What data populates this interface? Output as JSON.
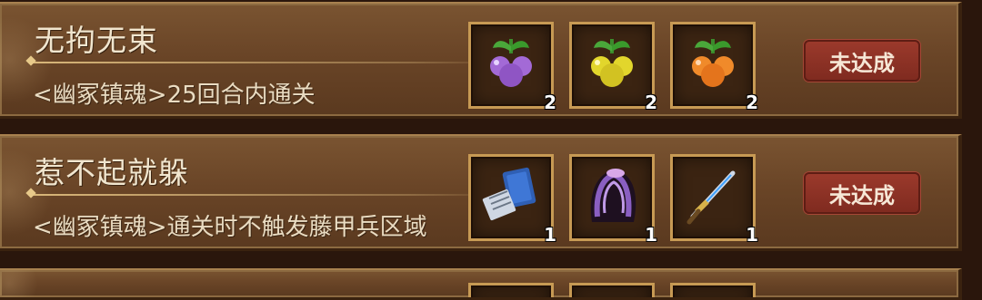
{
  "achievements": [
    {
      "title": "无拘无束",
      "desc": "<幽冢镇魂>25回合内通关",
      "status": "未达成",
      "rewards": [
        {
          "icon": "purple-grape-fruit-icon",
          "qty": "2",
          "color": "#a36ad6"
        },
        {
          "icon": "yellow-grape-fruit-icon",
          "qty": "2",
          "color": "#e2d62c"
        },
        {
          "icon": "orange-grape-fruit-icon",
          "qty": "2",
          "color": "#f08a2a"
        }
      ]
    },
    {
      "title": "惹不起就躲",
      "desc": "<幽冢镇魂>通关时不触发藤甲兵区域",
      "status": "未达成",
      "rewards": [
        {
          "icon": "blue-book-icon",
          "qty": "1"
        },
        {
          "icon": "dark-cloak-icon",
          "qty": "1"
        },
        {
          "icon": "blue-dagger-icon",
          "qty": "1"
        }
      ]
    }
  ]
}
